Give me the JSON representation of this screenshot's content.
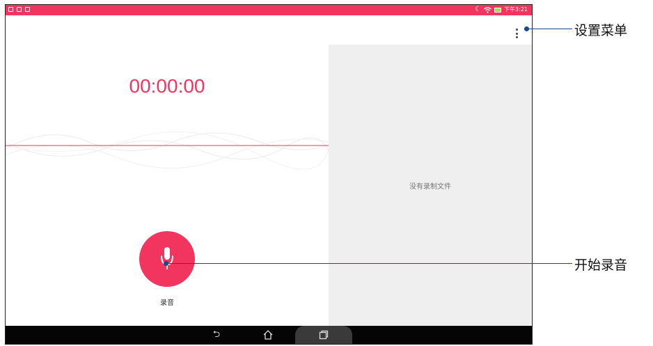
{
  "status_bar": {
    "time": "下午3:21",
    "icons": [
      "gallery-icon",
      "notification-icon",
      "notification-icon",
      "moon-icon",
      "wifi-icon",
      "battery-charging-icon"
    ]
  },
  "toolbar": {
    "menu_icon": "more-vert-icon"
  },
  "recorder": {
    "timer": "00:00:00",
    "record_label": "录音",
    "record_icon": "mic-icon"
  },
  "recordings": {
    "empty_text": "没有录制文件"
  },
  "nav_bar": {
    "back_icon": "back-icon",
    "home_icon": "home-icon",
    "recent_icon": "recent-apps-icon"
  },
  "annotations": {
    "settings_menu": "设置菜单",
    "start_recording": "开始录音"
  },
  "colors": {
    "accent": "#f2355e",
    "annotation_line": "#1b4a8a",
    "list_bg": "#efefef"
  }
}
